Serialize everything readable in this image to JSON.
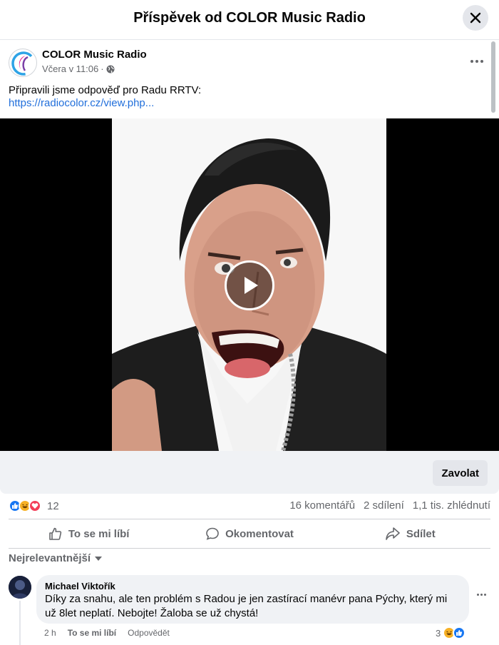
{
  "header": {
    "title": "Příspěvek od COLOR Music Radio",
    "close_icon": "close-icon"
  },
  "post": {
    "page_name": "COLOR Music Radio",
    "time": "Včera v 11:06",
    "separator": "·",
    "privacy_icon": "globe-icon",
    "text": "Připravili jsme odpověď pro Radu RRTV:",
    "link": "https://radiocolor.cz/view.php..."
  },
  "video": {
    "play_icon": "play-icon"
  },
  "cta": {
    "call_label": "Zavolat"
  },
  "stats": {
    "reactions_count": "12",
    "reaction_icons": [
      "like-icon",
      "haha-icon",
      "love-icon"
    ],
    "comments": "16 komentářů",
    "shares": "2 sdílení",
    "views": "1,1 tis. zhlédnutí"
  },
  "actions": {
    "like": "To se mi líbí",
    "comment": "Okomentovat",
    "share": "Sdílet"
  },
  "sort": {
    "label": "Nejrelevantnější"
  },
  "comment": {
    "author": "Michael Viktořík",
    "text": "Díky za snahu, ale ten problém s Radou je jen zastírací manévr pana Pýchy, který mi už 8let neplatí. Nebojte! Žaloba se už chystá!",
    "time": "2 h",
    "like": "To se mi líbí",
    "reply": "Odpovědět",
    "reaction_count": "3"
  },
  "colors": {
    "link": "#216fdb",
    "like_blue": "#1877f2",
    "love_red": "#f33e58",
    "haha_yellow": "#f7b125",
    "muted": "#65676b"
  }
}
